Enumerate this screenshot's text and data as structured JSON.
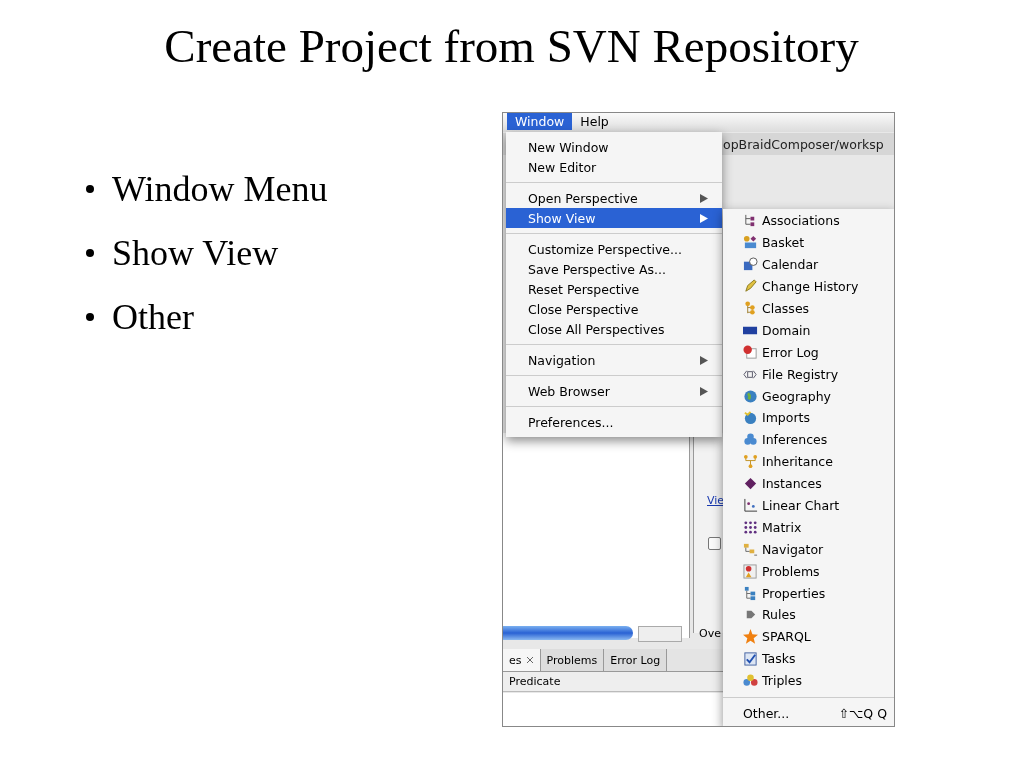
{
  "slide": {
    "title": "Create Project from SVN Repository",
    "bullets": [
      "Window Menu",
      "Show View",
      "Other"
    ]
  },
  "screenshot": {
    "menubar": [
      {
        "label": "Window",
        "selected": true
      },
      {
        "label": "Help",
        "selected": false
      }
    ],
    "background": {
      "path": "opBraidComposer/worksp",
      "link": "Vie",
      "checkbox_checked": false,
      "tab_fragment": "Ove",
      "bottom_tabs": [
        {
          "label": "es",
          "selected": true
        },
        {
          "label": "Problems",
          "selected": false
        },
        {
          "label": "Error Log",
          "selected": false
        }
      ],
      "column": "Predicate"
    },
    "window_menu": [
      [
        {
          "label": "New Window",
          "submenu": false,
          "selected": false
        },
        {
          "label": "New Editor",
          "submenu": false,
          "selected": false
        }
      ],
      [
        {
          "label": "Open Perspective",
          "submenu": true,
          "selected": false
        },
        {
          "label": "Show View",
          "submenu": true,
          "selected": true
        }
      ],
      [
        {
          "label": "Customize Perspective...",
          "submenu": false,
          "selected": false
        },
        {
          "label": "Save Perspective As...",
          "submenu": false,
          "selected": false
        },
        {
          "label": "Reset Perspective",
          "submenu": false,
          "selected": false
        },
        {
          "label": "Close Perspective",
          "submenu": false,
          "selected": false
        },
        {
          "label": "Close All Perspectives",
          "submenu": false,
          "selected": false
        }
      ],
      [
        {
          "label": "Navigation",
          "submenu": true,
          "selected": false
        }
      ],
      [
        {
          "label": "Web Browser",
          "submenu": true,
          "selected": false
        }
      ],
      [
        {
          "label": "Preferences...",
          "submenu": false,
          "selected": false
        }
      ]
    ],
    "show_view_menu": {
      "items": [
        "Associations",
        "Basket",
        "Calendar",
        "Change History",
        "Classes",
        "Domain",
        "Error Log",
        "File Registry",
        "Geography",
        "Imports",
        "Inferences",
        "Inheritance",
        "Instances",
        "Linear Chart",
        "Matrix",
        "Navigator",
        "Problems",
        "Properties",
        "Rules",
        "SPARQL",
        "Tasks",
        "Triples"
      ],
      "other": {
        "label": "Other...",
        "shortcut": "⇧⌥Q Q"
      }
    }
  }
}
